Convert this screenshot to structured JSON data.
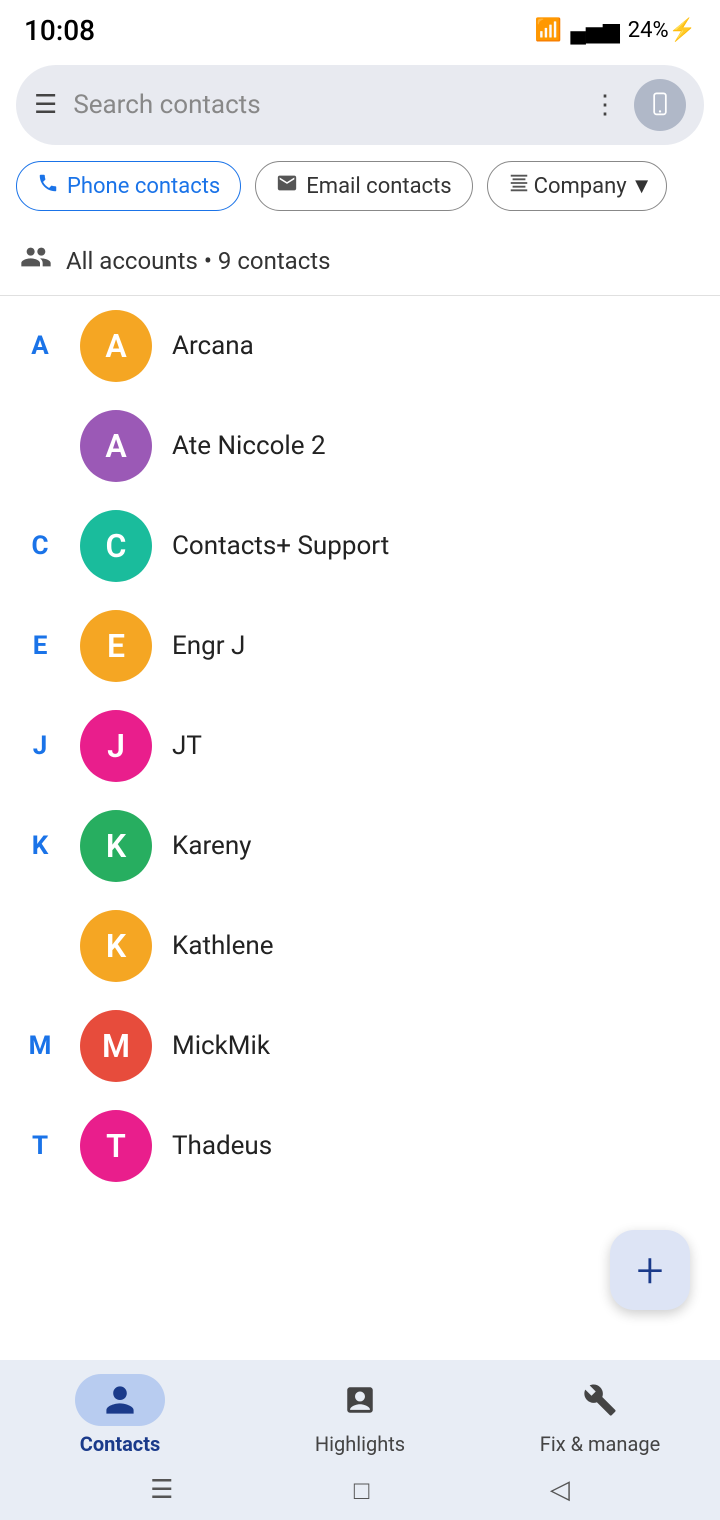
{
  "statusBar": {
    "time": "10:08",
    "battery": "24%",
    "batteryIcon": "⚡"
  },
  "searchBar": {
    "menuIcon": "≡",
    "placeholder": "Search contacts",
    "moreIcon": "⋮",
    "deviceIcon": "📱"
  },
  "filterChips": [
    {
      "id": "phone",
      "label": "Phone contacts",
      "icon": "📞",
      "active": true
    },
    {
      "id": "email",
      "label": "Email contacts",
      "icon": "✉"
    },
    {
      "id": "company",
      "label": "Company",
      "icon": "▦",
      "dropdown": true
    }
  ],
  "accountsRow": {
    "icon": "👥",
    "text": "All accounts • 9 contacts"
  },
  "contacts": [
    {
      "letter": "A",
      "name": "Arcana",
      "initial": "A",
      "color": "#F5A623"
    },
    {
      "letter": "",
      "name": "Ate Niccole 2",
      "initial": "A",
      "color": "#9B59B6"
    },
    {
      "letter": "C",
      "name": "Contacts+ Support",
      "initial": "C",
      "color": "#1ABC9C"
    },
    {
      "letter": "E",
      "name": "Engr J",
      "initial": "E",
      "color": "#F5A623"
    },
    {
      "letter": "J",
      "name": "JT",
      "initial": "J",
      "color": "#E91E8C"
    },
    {
      "letter": "K",
      "name": "Kareny",
      "initial": "K",
      "color": "#27AE60"
    },
    {
      "letter": "",
      "name": "Kathlene",
      "initial": "K",
      "color": "#F5A623"
    },
    {
      "letter": "M",
      "name": "MickMik",
      "initial": "M",
      "color": "#E74C3C"
    },
    {
      "letter": "T",
      "name": "Thadeus",
      "initial": "T",
      "color": "#E91E8C"
    }
  ],
  "fab": {
    "icon": "+",
    "label": "Add contact"
  },
  "bottomNav": [
    {
      "id": "contacts",
      "label": "Contacts",
      "active": true
    },
    {
      "id": "highlights",
      "label": "Highlights",
      "active": false
    },
    {
      "id": "fix",
      "label": "Fix & manage",
      "active": false
    }
  ],
  "sysNav": {
    "menu": "☰",
    "home": "□",
    "back": "◁"
  }
}
